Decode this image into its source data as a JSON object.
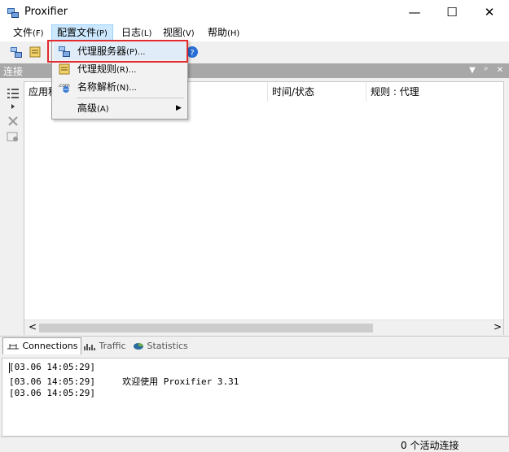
{
  "window": {
    "title": "Proxifier",
    "minimize": "—",
    "maximize": "☐",
    "close": "✕"
  },
  "menu": {
    "items": [
      {
        "label": "文件",
        "accel": "(F)"
      },
      {
        "label": "配置文件",
        "accel": "(P)"
      },
      {
        "label": "日志",
        "accel": "(L)"
      },
      {
        "label": "视图",
        "accel": "(V)"
      },
      {
        "label": "帮助",
        "accel": "(H)"
      }
    ]
  },
  "dropdown": {
    "items": [
      {
        "label": "代理服务器",
        "accel": "(P)...",
        "icon": "proxy-server-icon"
      },
      {
        "label": "代理规则",
        "accel": "(R)...",
        "icon": "proxy-rules-icon"
      },
      {
        "label": "名称解析",
        "accel": "(N)...",
        "icon": "name-resolution-icon"
      },
      {
        "label": "高级",
        "accel": "(A)",
        "icon": "",
        "submenu": "▶"
      }
    ]
  },
  "connections_panel": {
    "title": "连接",
    "header_buttons": [
      "▼",
      "ᵖ",
      "✕"
    ],
    "columns": [
      "应用程序",
      "时间/状态",
      "规则 : 代理"
    ],
    "scroll_left": "<",
    "scroll_right": ">"
  },
  "tabs": [
    {
      "label": "Connections",
      "icon": "connections-icon",
      "active": true
    },
    {
      "label": "Traffic",
      "icon": "traffic-icon",
      "active": false
    },
    {
      "label": "Statistics",
      "icon": "statistics-icon",
      "active": false
    }
  ],
  "log": {
    "lines": [
      "[03.06 14:05:29]",
      "[03.06 14:05:29]     欢迎使用 Proxifier 3.31",
      "[03.06 14:05:29]"
    ]
  },
  "status": {
    "text": "0 个活动连接"
  },
  "colors": {
    "highlight": "#e12b31",
    "panel_header": "#a8a8a8",
    "menu_active": "#cce8ff"
  }
}
